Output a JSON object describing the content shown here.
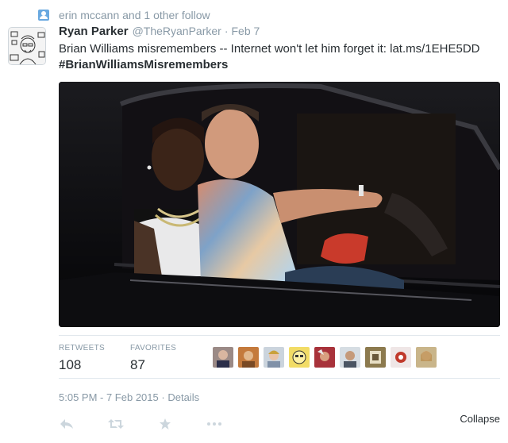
{
  "context": {
    "text": "erin mccann and 1 other follow",
    "icon": "person-icon"
  },
  "author": {
    "name": "Ryan Parker",
    "handle": "@TheRyanParker",
    "separator": "·",
    "date": "Feb 7"
  },
  "tweet": {
    "line1": "Brian Williams misremembers -- Internet won't let him forget it: lat.ms/1EHE5DD",
    "hashtag": "#BrianWilliamsMisremembers"
  },
  "stats": {
    "retweets_label": "RETWEETS",
    "retweets_value": "108",
    "favorites_label": "FAVORITES",
    "favorites_value": "87"
  },
  "timestamp": {
    "time": "5:05 PM - 7 Feb 2015",
    "separator": "·",
    "details": "Details"
  },
  "actions": {
    "icons": [
      "reply-icon",
      "retweet-icon",
      "favorite-icon",
      "more-icon"
    ],
    "collapse": "Collapse"
  },
  "colors": {
    "text": "#292f33",
    "muted": "#8899a6",
    "action_icon": "#ccd6dd",
    "divider": "#e1e8ed",
    "context_icon": "#6aa9e0"
  }
}
